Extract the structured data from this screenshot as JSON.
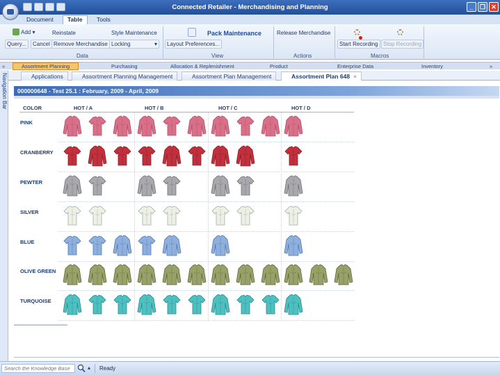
{
  "window": {
    "title": "Connected Retailer - Merchandising and Planning",
    "controls": {
      "minimize": "_",
      "maximize": "❐",
      "close": "✕"
    }
  },
  "ribbon_tabs": [
    "Document",
    "Table",
    "Tools"
  ],
  "ribbon": {
    "data": {
      "add": "Add",
      "reinstate": "Reinstate",
      "query": "Query...",
      "cancel": "Cancel",
      "remove": "Remove Merchandise",
      "style_maintenance": "Style Maintenance",
      "locking": "Locking",
      "group_label": "Data"
    },
    "view": {
      "pack_maintenance": "Pack Maintenance",
      "layout_preferences": "Layout Preferences...",
      "group_label": "View"
    },
    "actions": {
      "release_merchandise": "Release Merchandise",
      "group_label": "Actions"
    },
    "macros": {
      "start_recording": "Start Recording",
      "stop_recording": "Stop Recording",
      "group_label": "Macros"
    }
  },
  "modules": [
    "Assortment Planning",
    "Purchasing",
    "Allocation & Replenishment",
    "Product",
    "Enterprise Data",
    "Inventory"
  ],
  "module_nav": {
    "left": "«",
    "right": "»"
  },
  "navigation_bar_label": "Navigation Bar",
  "doc_tabs": [
    "Applications",
    "Assortment Planning Management",
    "Assortment Plan Management",
    "Assortment Plan 648"
  ],
  "doc_tab_close": "×",
  "plan_header": "000000648 - Test 25.1 : February, 2009 - April, 2009",
  "grid": {
    "color_header": "COLOR",
    "groups": [
      "HOT / A",
      "HOT / B",
      "HOT / C",
      "HOT / D"
    ],
    "rows": [
      {
        "color": "PINK",
        "hex": "#d9708a",
        "shade": "#b24e68",
        "slots": [
          "long",
          "tee",
          "long",
          "long",
          "tee",
          "long",
          "long",
          "tee",
          "long",
          "long",
          null,
          null
        ]
      },
      {
        "color": "CRANBERRY",
        "hex": "#c0303d",
        "shade": "#8d1f29",
        "slots": [
          "tee",
          "long",
          "tee",
          "tee",
          "long",
          "tee",
          "long",
          "long",
          null,
          "tee",
          null,
          null
        ]
      },
      {
        "color": "PEWTER",
        "hex": "#a9a9ad",
        "shade": "#6f7076",
        "slots": [
          "long",
          "tee",
          null,
          "long",
          "tee",
          null,
          "long",
          "tee",
          null,
          "long",
          null,
          null
        ]
      },
      {
        "color": "SILVER",
        "hex": "#eef0e6",
        "shade": "#9fb2a4",
        "slots": [
          "tee",
          "tee",
          null,
          "tee",
          "tee",
          null,
          "tee",
          "tee",
          null,
          "tee",
          null,
          null
        ]
      },
      {
        "color": "BLUE",
        "hex": "#8fb0dc",
        "shade": "#4f78b4",
        "slots": [
          "tee",
          "tee",
          "long",
          "tee",
          "long",
          null,
          "long",
          null,
          null,
          "long",
          null,
          null
        ]
      },
      {
        "color": "OLIVE GREEN",
        "hex": "#98a268",
        "shade": "#5f6a3c",
        "slots": [
          "long",
          "long",
          "long",
          "long",
          "long",
          "long",
          "long",
          "long",
          "long",
          "long",
          "long",
          "long"
        ]
      },
      {
        "color": "TURQUOISE",
        "hex": "#4fc0c0",
        "shade": "#268c90",
        "slots": [
          "long",
          "tee",
          "tee",
          "long",
          "tee",
          "tee",
          "long",
          "tee",
          "tee",
          "long",
          null,
          null
        ]
      }
    ]
  },
  "statusbar": {
    "search_placeholder": "Search the Knowledge Base",
    "status": "Ready"
  }
}
